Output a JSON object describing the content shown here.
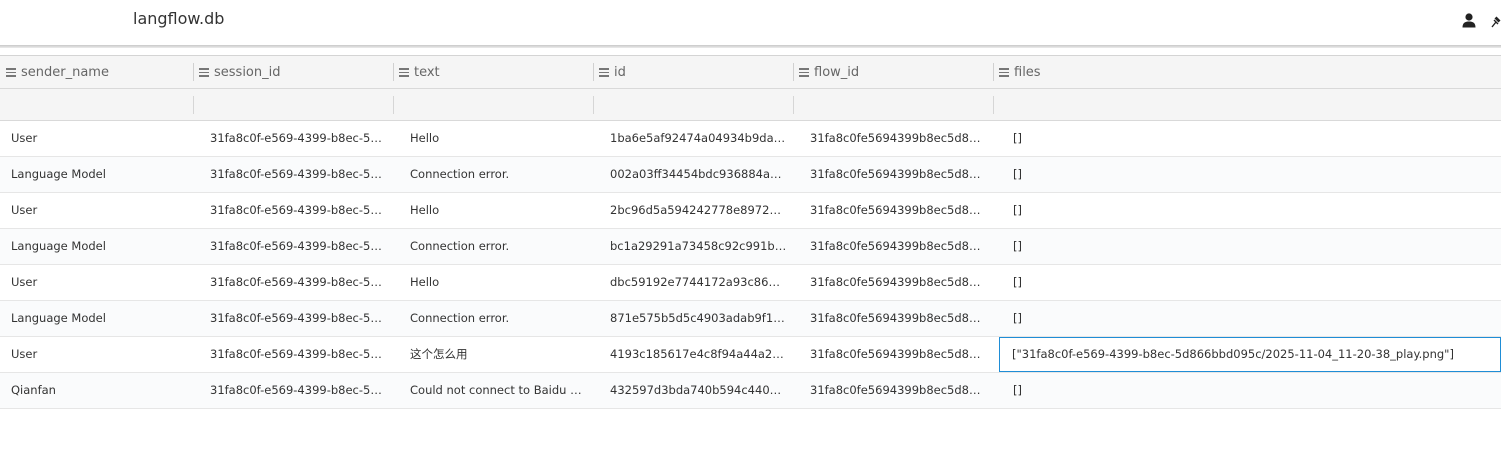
{
  "window": {
    "title": "langflow.db"
  },
  "icons": {
    "user": "user-icon",
    "pin": "pin-icon",
    "menu": "column-menu-icon"
  },
  "columns": [
    "sender_name",
    "session_id",
    "text",
    "id",
    "flow_id",
    "files"
  ],
  "rows": [
    [
      "User",
      "31fa8c0f-e569-4399-b8ec-5d8…",
      "Hello",
      "1ba6e5af92474a04934b9da26d…",
      "31fa8c0fe5694399b8ec5d866b…",
      "[]"
    ],
    [
      "Language Model",
      "31fa8c0f-e569-4399-b8ec-5d8…",
      "Connection error.",
      "002a03ff34454bdc936884a813…",
      "31fa8c0fe5694399b8ec5d866b…",
      "[]"
    ],
    [
      "User",
      "31fa8c0f-e569-4399-b8ec-5d8…",
      "Hello",
      "2bc96d5a594242778e8972348…",
      "31fa8c0fe5694399b8ec5d866b…",
      "[]"
    ],
    [
      "Language Model",
      "31fa8c0f-e569-4399-b8ec-5d8…",
      "Connection error.",
      "bc1a29291a73458c92c991b441…",
      "31fa8c0fe5694399b8ec5d866b…",
      "[]"
    ],
    [
      "User",
      "31fa8c0f-e569-4399-b8ec-5d8…",
      "Hello",
      "dbc59192e7744172a93c867463…",
      "31fa8c0fe5694399b8ec5d866b…",
      "[]"
    ],
    [
      "Language Model",
      "31fa8c0f-e569-4399-b8ec-5d8…",
      "Connection error.",
      "871e575b5d5c4903adab9f1b4b…",
      "31fa8c0fe5694399b8ec5d866b…",
      "[]"
    ],
    [
      "User",
      "31fa8c0f-e569-4399-b8ec-5d8…",
      "这个怎么用",
      "4193c185617e4c8f94a44a2cab…",
      "31fa8c0fe5694399b8ec5d866b…",
      "[\"31fa8c0f-e569-4399-b8ec-5d866bbd095c/2025-11-04_11-20-38_play.png\"]"
    ],
    [
      "Qianfan",
      "31fa8c0f-e569-4399-b8ec-5d8…",
      "Could not connect to Baidu Qia…",
      "432597d3bda740b594c440b34…",
      "31fa8c0fe5694399b8ec5d866b…",
      "[]"
    ]
  ],
  "selected_cell": {
    "row": 6,
    "column": 5
  }
}
